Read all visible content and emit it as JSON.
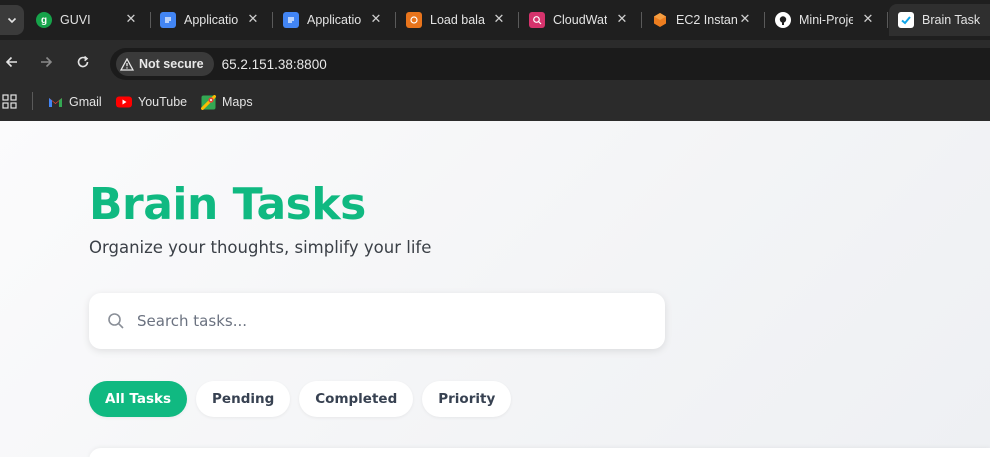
{
  "browser": {
    "tabs": [
      {
        "title": "GUVI",
        "icon": "guvi-icon",
        "color": "#16a34a"
      },
      {
        "title": "Applicatio",
        "icon": "docs-icon",
        "color": "#4285f4"
      },
      {
        "title": "Applicatio",
        "icon": "docs-icon",
        "color": "#4285f4"
      },
      {
        "title": "Load bala",
        "icon": "aws-elb-icon",
        "color": "#e8741c"
      },
      {
        "title": "CloudWat",
        "icon": "aws-cloudwatch-icon",
        "color": "#d6336c"
      },
      {
        "title": "EC2 Instan",
        "icon": "aws-ec2-icon",
        "color": "#ed7d1f"
      },
      {
        "title": "Mini-Proje",
        "icon": "github-icon",
        "color": "#ffffff"
      },
      {
        "title": "Brain Task",
        "icon": "checkmark-icon",
        "color": "#0ea5e9"
      }
    ],
    "security_chip": "Not secure",
    "url": "65.2.151.38:8800",
    "bookmarks": [
      {
        "label": "Gmail",
        "icon": "gmail-icon"
      },
      {
        "label": "YouTube",
        "icon": "youtube-icon"
      },
      {
        "label": "Maps",
        "icon": "maps-icon"
      }
    ]
  },
  "app": {
    "title": "Brain Tasks",
    "subtitle": "Organize your thoughts, simplify your life",
    "search_placeholder": "Search tasks...",
    "filters": [
      "All Tasks",
      "Pending",
      "Completed",
      "Priority"
    ],
    "active_filter": "All Tasks",
    "accent_color": "#10b981"
  }
}
